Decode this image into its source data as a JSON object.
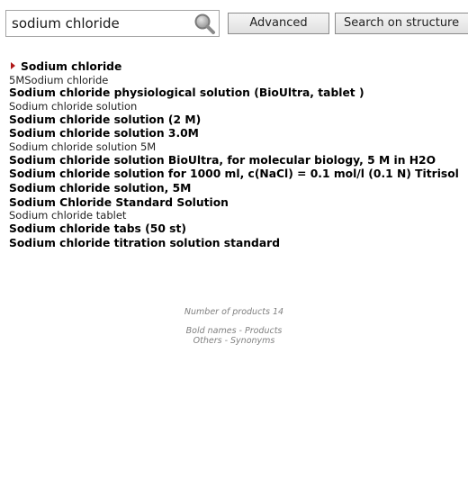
{
  "search": {
    "query": "sodium chloride",
    "advanced_label": "Advanced",
    "structure_label": "Search on structure"
  },
  "results": [
    {
      "text": "Sodium chloride",
      "type": "product",
      "selected": true
    },
    {
      "text": "5MSodium chloride",
      "type": "synonym"
    },
    {
      "text": "Sodium chloride physiological solution (BioUltra, tablet )",
      "type": "product"
    },
    {
      "text": "Sodium chloride solution",
      "type": "synonym"
    },
    {
      "text": "Sodium chloride solution (2 M)",
      "type": "product"
    },
    {
      "text": "Sodium chloride solution 3.0M",
      "type": "product"
    },
    {
      "text": "Sodium chloride solution 5M",
      "type": "synonym"
    },
    {
      "text": "Sodium chloride solution BioUltra, for molecular biology, 5 M in H2O",
      "type": "product"
    },
    {
      "text": "Sodium chloride solution for 1000 ml, c(NaCl) = 0.1 mol/l (0.1 N) Titrisol",
      "type": "product"
    },
    {
      "text": "Sodium chloride solution, 5M",
      "type": "product"
    },
    {
      "text": "Sodium Chloride Standard Solution",
      "type": "product"
    },
    {
      "text": "Sodium chloride tablet",
      "type": "synonym"
    },
    {
      "text": "Sodium chloride tabs (50 st)",
      "type": "product"
    },
    {
      "text": "Sodium chloride titration solution standard",
      "type": "product"
    }
  ],
  "footer": {
    "count_text": "Number of products 14",
    "legend_bold": "Bold names - Products",
    "legend_others": "Others - Synonyms"
  },
  "colors": {
    "marker": "#b01818",
    "footer_text": "#808080"
  }
}
